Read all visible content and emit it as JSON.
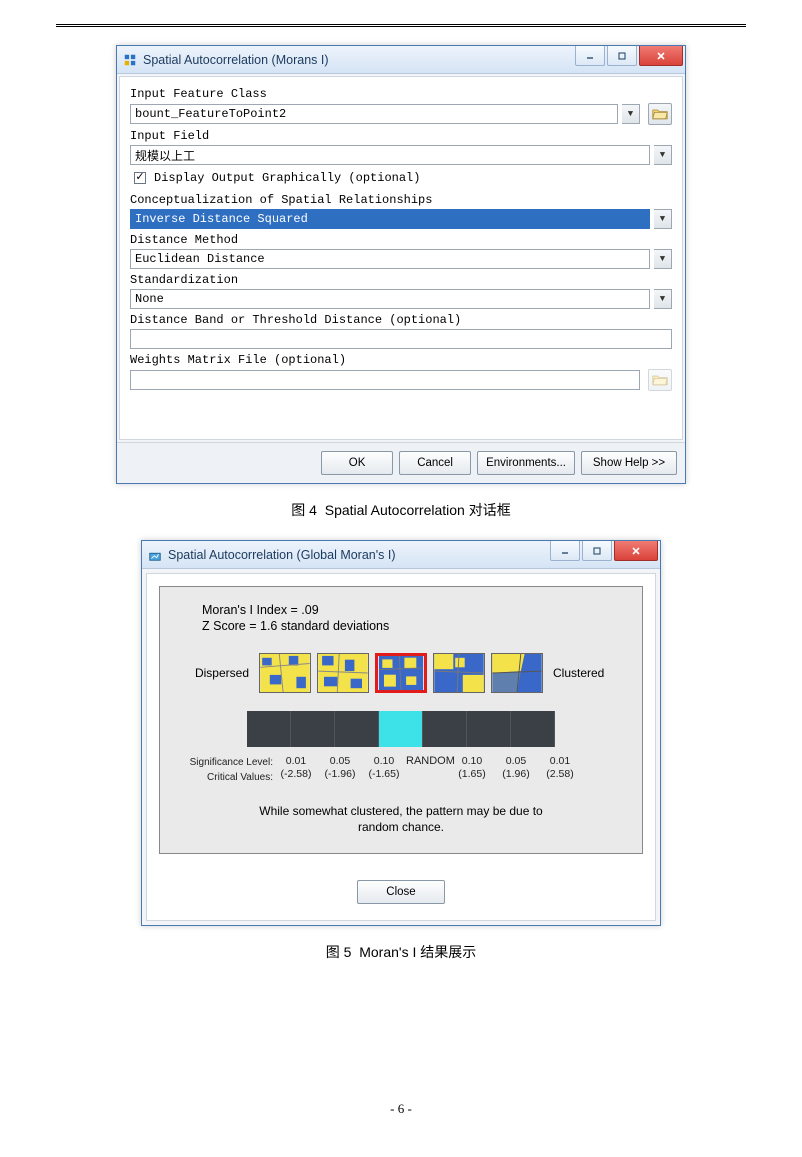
{
  "header_rule": "",
  "figure1": {
    "window_title": "Spatial Autocorrelation (Morans I)",
    "labels": {
      "input_feature_class": "Input Feature Class",
      "input_field": "Input Field",
      "display_output": "Display Output Graphically (optional)",
      "conceptualization": "Conceptualization of Spatial Relationships",
      "distance_method": "Distance Method",
      "standardization": "Standardization",
      "distance_band": "Distance Band or Threshold Distance (optional)",
      "weights_matrix": "Weights Matrix File (optional)"
    },
    "values": {
      "input_feature_class": "bount_FeatureToPoint2",
      "input_field": "规模以上工",
      "conceptualization": "Inverse Distance Squared",
      "distance_method": "Euclidean Distance",
      "standardization": "None",
      "distance_band": "",
      "weights_matrix": ""
    },
    "display_output_checked": true,
    "buttons": {
      "ok": "OK",
      "cancel": "Cancel",
      "environments": "Environments...",
      "show_help": "Show Help >>"
    },
    "caption_prefix": "图 4",
    "caption_text": "Spatial Autocorrelation 对话框"
  },
  "figure2": {
    "window_title": "Spatial Autocorrelation (Global Moran's I)",
    "stats": {
      "index": "Moran's I Index = .09",
      "zscore": "Z Score = 1.6 standard deviations"
    },
    "pattern": {
      "dispersed_label": "Dispersed",
      "clustered_label": "Clustered",
      "highlight_index": 2
    },
    "significance": {
      "row1_label": "Significance Level:",
      "row2_label": "Critical Values:",
      "cells": [
        {
          "sig": "0.01",
          "crit": "(-2.58)"
        },
        {
          "sig": "0.05",
          "crit": "(-1.96)"
        },
        {
          "sig": "0.10",
          "crit": "(-1.65)"
        },
        {
          "sig": "RANDOM",
          "crit": ""
        },
        {
          "sig": "0.10",
          "crit": "(1.65)"
        },
        {
          "sig": "0.05",
          "crit": "(1.96)"
        },
        {
          "sig": "0.01",
          "crit": "(2.58)"
        }
      ]
    },
    "conclusion": "While somewhat clustered, the pattern may be due to\nrandom chance.",
    "close_button": "Close",
    "caption_prefix": "图 5",
    "caption_text": "Moran's I 结果展示"
  },
  "page_number": "- 6 -"
}
